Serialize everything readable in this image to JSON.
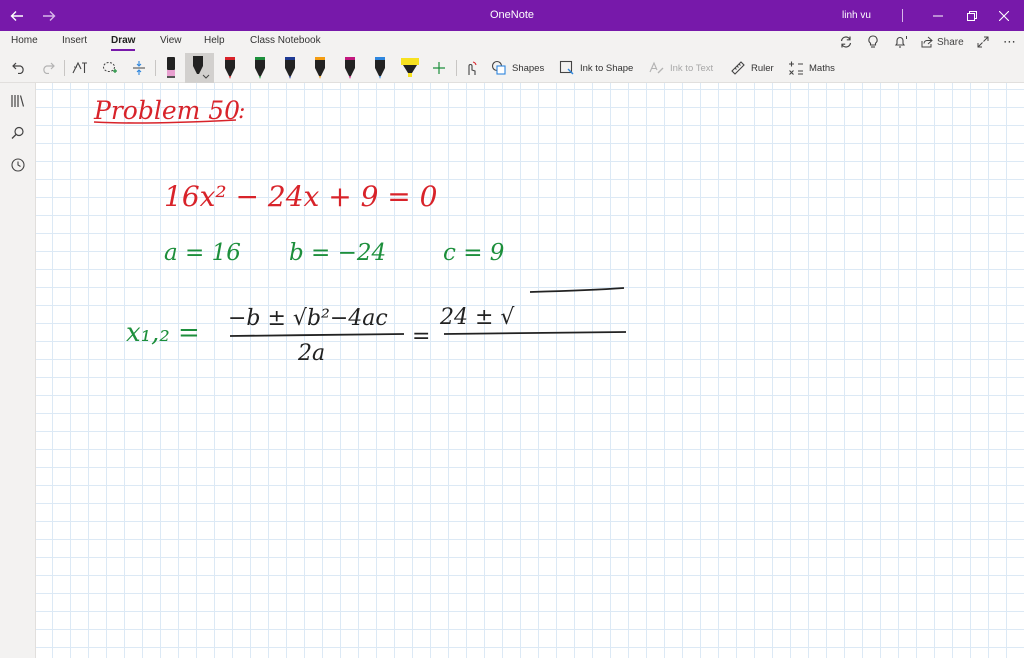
{
  "window": {
    "title": "OneNote",
    "user": "linh vu"
  },
  "ribbon": {
    "tabs": [
      {
        "label": "Home"
      },
      {
        "label": "Insert"
      },
      {
        "label": "Draw",
        "active": true
      },
      {
        "label": "View"
      },
      {
        "label": "Help"
      },
      {
        "label": "Class Notebook"
      }
    ],
    "share_label": "Share"
  },
  "toolbar": {
    "shapes_label": "Shapes",
    "ink_to_shape_label": "Ink to Shape",
    "ink_to_text_label": "Ink to Text",
    "ruler_label": "Ruler",
    "maths_label": "Maths",
    "pens": [
      {
        "icon": "pen-pink-icon",
        "color": "#e8a0d0"
      },
      {
        "icon": "pen-black-selected-icon",
        "color": "#222222"
      },
      {
        "icon": "pen-red-icon",
        "color": "#d8232a"
      },
      {
        "icon": "pen-green-icon",
        "color": "#1d8f3c"
      },
      {
        "icon": "pen-dark-blue-icon",
        "color": "#1f3a93"
      },
      {
        "icon": "pen-orange-icon",
        "color": "#f39c12"
      },
      {
        "icon": "pen-magenta-icon",
        "color": "#c2187e"
      },
      {
        "icon": "pen-blue-icon",
        "color": "#2e86de"
      },
      {
        "icon": "highlighter-yellow-icon",
        "color": "#f7e11f"
      }
    ]
  },
  "colors": {
    "accent": "#7719aa",
    "ink_red": "#d8232a",
    "ink_green": "#1d8f3c",
    "ink_black": "#222222",
    "grid": "#dce9f5"
  },
  "page_ink": {
    "heading": "Problem 50",
    "heading_colon": ":",
    "equation": "16x² − 24x + 9 = 0",
    "coef_a": "a = 16",
    "coef_b": "b = −24",
    "coef_c": "c = 9",
    "formula_lhs": "x₁,₂ =",
    "formula_numerator": "−b ± √b²−4ac",
    "formula_denominator": "2a",
    "formula_equals": "=",
    "formula_substituted": "24 ± √"
  }
}
